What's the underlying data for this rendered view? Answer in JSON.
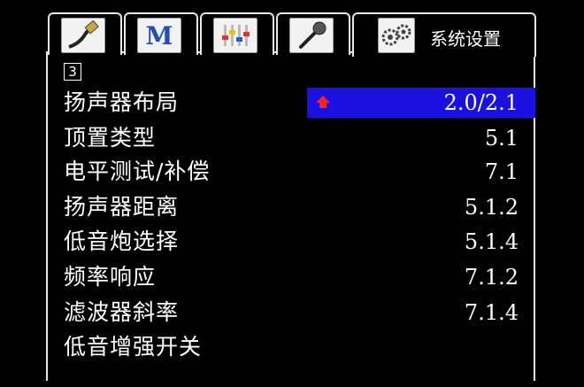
{
  "tabs": [
    {
      "name": "hdmi-cable-icon"
    },
    {
      "name": "m-logo-icon",
      "glyph": "M"
    },
    {
      "name": "equalizer-icon"
    },
    {
      "name": "microphone-icon"
    },
    {
      "name": "system-settings-gears-icon",
      "label": "系统设置"
    }
  ],
  "page_indicator": "3",
  "menu_items": [
    "扬声器布局",
    "顶置类型",
    "电平测试/补偿",
    "扬声器距离",
    "低音炮选择",
    "频率响应",
    "滤波器斜率",
    "低音增强开关"
  ],
  "options": [
    "2.0/2.1",
    "5.1",
    "7.1",
    "5.1.2",
    "5.1.4",
    "7.1.2",
    "7.1.4"
  ],
  "colors": {
    "highlight": "#1a10e0",
    "arrow": "#ff2020",
    "border": "#e6e6e6"
  }
}
